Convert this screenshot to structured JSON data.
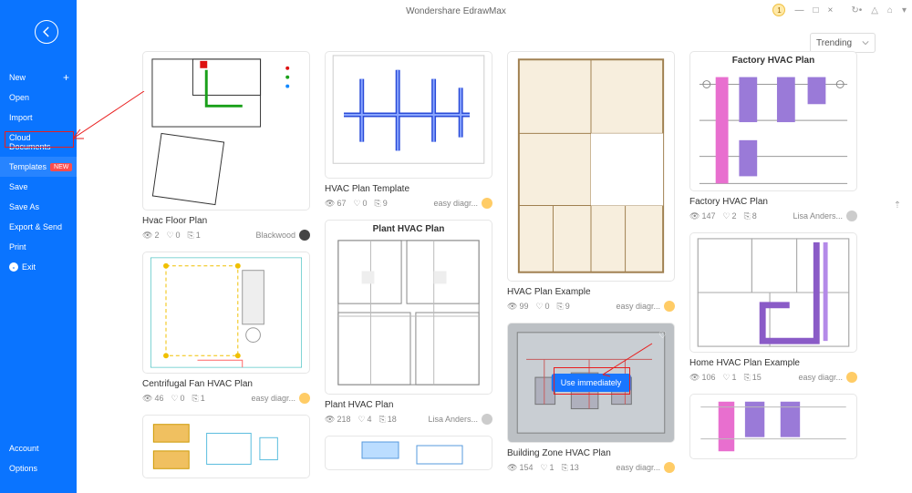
{
  "app": {
    "title": "Wondershare EdrawMax"
  },
  "window": {
    "notif": "1"
  },
  "sidebar": {
    "items": [
      {
        "label": "New"
      },
      {
        "label": "Open"
      },
      {
        "label": "Import"
      },
      {
        "label": "Cloud Documents"
      },
      {
        "label": "Templates",
        "badge": "NEW"
      },
      {
        "label": "Save"
      },
      {
        "label": "Save As"
      },
      {
        "label": "Export & Send"
      },
      {
        "label": "Print"
      },
      {
        "label": "Exit"
      }
    ],
    "bottom": [
      {
        "label": "Account"
      },
      {
        "label": "Options"
      }
    ]
  },
  "sort": {
    "label": "Trending"
  },
  "cards": {
    "c1": {
      "title": "Hvac Floor Plan",
      "views": "2",
      "likes": "0",
      "copies": "1",
      "author": "Blackwood"
    },
    "c2": {
      "title": "HVAC Plan Template",
      "views": "67",
      "likes": "0",
      "copies": "9",
      "author": "easy diagr..."
    },
    "c3": {
      "title": "HVAC Plan Example",
      "views": "99",
      "likes": "0",
      "copies": "9",
      "author": "easy diagr..."
    },
    "c4": {
      "title": "Factory HVAC Plan",
      "thumbTitle": "Factory HVAC Plan",
      "views": "147",
      "likes": "2",
      "copies": "8",
      "author": "Lisa Anders..."
    },
    "c5": {
      "title": "Centrifugal Fan HVAC Plan",
      "views": "46",
      "likes": "0",
      "copies": "1",
      "author": "easy diagr..."
    },
    "c6": {
      "title": "Plant HVAC Plan",
      "thumbTitle": "Plant HVAC Plan",
      "views": "218",
      "likes": "4",
      "copies": "18",
      "author": "Lisa Anders..."
    },
    "c7": {
      "title": "Building Zone HVAC Plan",
      "views": "154",
      "likes": "1",
      "copies": "13",
      "author": "easy diagr...",
      "button": "Use immediately"
    },
    "c8": {
      "title": "Home HVAC Plan Example",
      "views": "106",
      "likes": "1",
      "copies": "15",
      "author": "easy diagr..."
    }
  }
}
